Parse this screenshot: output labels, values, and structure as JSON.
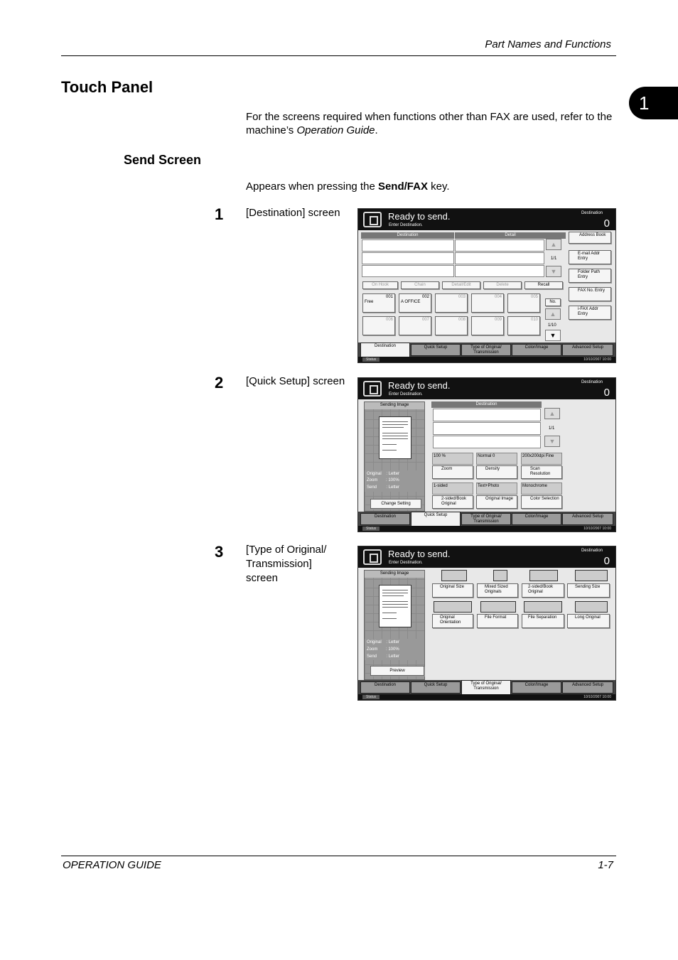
{
  "header": {
    "section": "Part Names and Functions",
    "chapter_number": "1"
  },
  "title": "Touch Panel",
  "intro": {
    "before": "For the screens required when functions other than FAX are used, refer to the machine’s ",
    "italic": "Operation Guide",
    "after": "."
  },
  "send_screen": {
    "heading": "Send Screen",
    "appears_prefix": "Appears when pressing the ",
    "appears_key": "Send/FAX",
    "appears_suffix": " key."
  },
  "steps": [
    {
      "number": "1",
      "label": "[Destination] screen"
    },
    {
      "number": "2",
      "label": "[Quick Setup] screen"
    },
    {
      "number": "3",
      "label": "[Type of Original/ Transmission] screen"
    }
  ],
  "panel_common": {
    "ready": "Ready to send.",
    "enter": "Enter Destination.",
    "dest_label": "Destination",
    "dest_count": "0",
    "tabs": [
      "Destination",
      "Quick Setup",
      "Type of Original/ Transmission",
      "Color/Image",
      "Advanced Setup"
    ],
    "status": "Status",
    "datetime": "10/10/2007 10:00"
  },
  "destination_screen": {
    "col_dest": "Destination",
    "col_detail": "Detail",
    "page": "1/1",
    "side_buttons": [
      "Address Book",
      "E-mail Addr Entry",
      "Folder Path Entry",
      "FAX No. Entry",
      "i-FAX Addr Entry"
    ],
    "action_buttons": [
      "On Hook",
      "Chain",
      "Detail/Edit",
      "Delete",
      "Recall"
    ],
    "one_touch": [
      {
        "num": "001",
        "name": "Free"
      },
      {
        "num": "002",
        "name": "A OFFICE"
      },
      {
        "num": "003",
        "name": ""
      },
      {
        "num": "004",
        "name": ""
      },
      {
        "num": "005",
        "name": ""
      },
      {
        "num": "006",
        "name": ""
      },
      {
        "num": "007",
        "name": ""
      },
      {
        "num": "008",
        "name": ""
      },
      {
        "num": "009",
        "name": ""
      },
      {
        "num": "010",
        "name": ""
      }
    ],
    "no_button": "No.",
    "key_page": "1/10"
  },
  "quick_setup_screen": {
    "sending_image": "Sending Image",
    "dest_header": "Destination",
    "page": "1/1",
    "info": [
      {
        "key": "Original",
        "val": ": Letter"
      },
      {
        "key": "Zoom",
        "val": ": 100%"
      },
      {
        "key": "Send",
        "val": ": Letter"
      }
    ],
    "change_setting": "Change Setting",
    "settings": [
      {
        "value": "100 %",
        "button": "Zoom"
      },
      {
        "value": "Normal 0",
        "button": "Density"
      },
      {
        "value": "200x200dpi Fine",
        "button": "Scan Resolution"
      },
      {
        "value": "1-sided",
        "button": "2-sided/Book Original"
      },
      {
        "value": "Text+Photo",
        "button": "Original Image"
      },
      {
        "value": "Monochrome",
        "button": "Color Selection"
      }
    ]
  },
  "type_original_screen": {
    "sending_image": "Sending Image",
    "info": [
      {
        "key": "Original",
        "val": ": Letter"
      },
      {
        "key": "Zoom",
        "val": ": 100%"
      },
      {
        "key": "Send",
        "val": ": Letter"
      }
    ],
    "preview": "Preview",
    "buttons": [
      "Original Size",
      "Mixed Sized Originals",
      "2-sided/Book Original",
      "Sending Size",
      "Original Orientation",
      "File Format",
      "File Separation",
      "Long Original"
    ]
  },
  "footer": {
    "left": "OPERATION GUIDE",
    "right": "1-7"
  }
}
